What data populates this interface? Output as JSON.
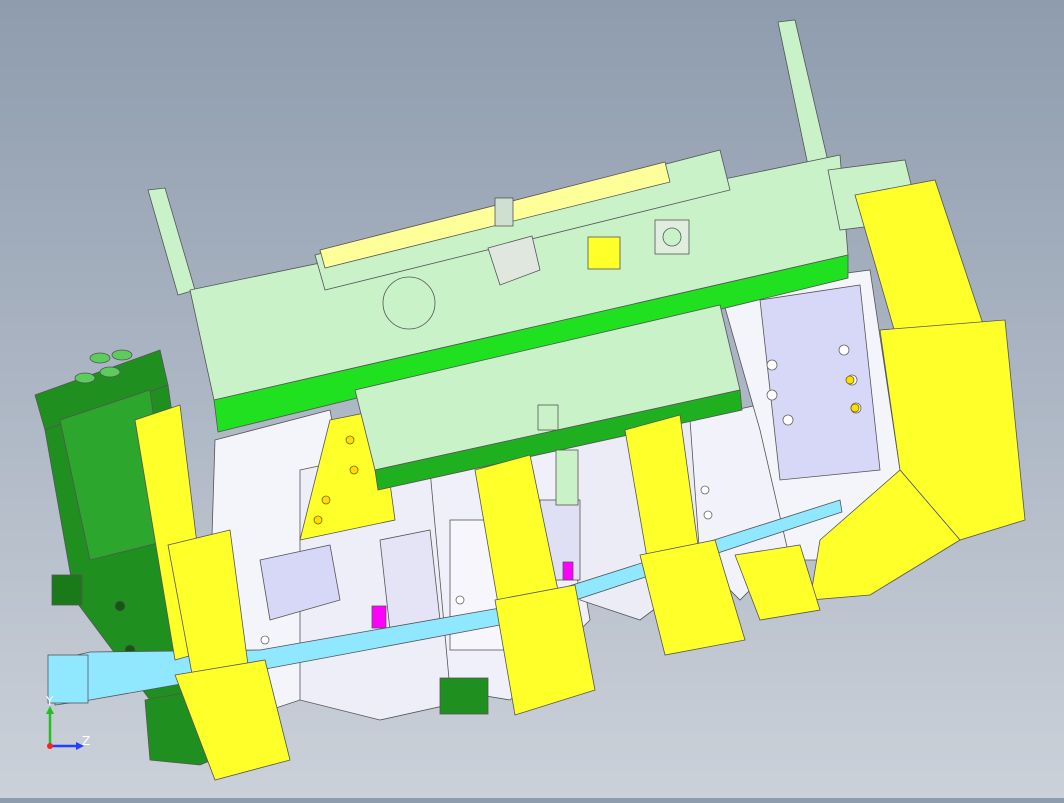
{
  "viewport": {
    "colors": {
      "background_top": "#8e9cad",
      "background_bottom": "#cbd1d9",
      "mint_green": "#c9f2c9",
      "bright_green": "#1fe11f",
      "dark_green": "#1f8f1f",
      "yellow": "#ffff2a",
      "light_blue": "#8fe8ff",
      "lavender": "#d7d7f7",
      "white_parts": "#f4f4fb",
      "magenta": "#ff00ff"
    }
  },
  "triad": {
    "x_label": "",
    "y_label": "Y",
    "z_label": "Z"
  }
}
